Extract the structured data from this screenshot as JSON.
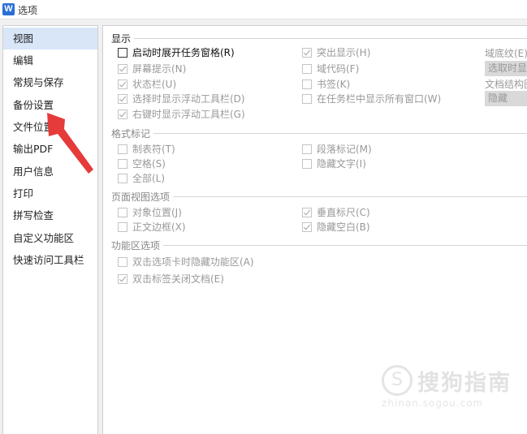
{
  "window": {
    "title": "选项",
    "icon": "wps-writer-icon"
  },
  "sidebar": {
    "selected": 0,
    "items": [
      {
        "label": "视图"
      },
      {
        "label": "编辑"
      },
      {
        "label": "常规与保存"
      },
      {
        "label": "备份设置"
      },
      {
        "label": "文件位置"
      },
      {
        "label": "输出PDF"
      },
      {
        "label": "用户信息"
      },
      {
        "label": "打印"
      },
      {
        "label": "拼写检查"
      },
      {
        "label": "自定义功能区"
      },
      {
        "label": "快速访问工具栏"
      }
    ]
  },
  "sections": {
    "display": {
      "title": "显示",
      "col1": [
        {
          "label": "启动时展开任务窗格(R)",
          "checked": false,
          "enabled": true
        },
        {
          "label": "屏幕提示(N)",
          "checked": true,
          "enabled": false
        },
        {
          "label": "状态栏(U)",
          "checked": true,
          "enabled": false
        },
        {
          "label": "选择时显示浮动工具栏(D)",
          "checked": true,
          "enabled": false
        },
        {
          "label": "右键时显示浮动工具栏(G)",
          "checked": true,
          "enabled": false
        }
      ],
      "col2": [
        {
          "label": "突出显示(H)",
          "checked": true,
          "enabled": false
        },
        {
          "label": "域代码(F)",
          "checked": false,
          "enabled": false
        },
        {
          "label": "书签(K)",
          "checked": false,
          "enabled": false
        },
        {
          "label": "在任务栏中显示所有窗口(W)",
          "checked": false,
          "enabled": false
        }
      ],
      "field_shading_label": "域底纹(E)",
      "field_shading_value": "选取时显示",
      "doc_map_label": "文档结构图",
      "doc_map_value": "隐藏"
    },
    "format_marks": {
      "title": "格式标记",
      "col1": [
        {
          "label": "制表符(T)",
          "checked": false
        },
        {
          "label": "空格(S)",
          "checked": false
        },
        {
          "label": "全部(L)",
          "checked": false
        }
      ],
      "col2": [
        {
          "label": "段落标记(M)",
          "checked": false
        },
        {
          "label": "隐藏文字(I)",
          "checked": false
        }
      ]
    },
    "page_view": {
      "title": "页面视图选项",
      "col1": [
        {
          "label": "对象位置(J)",
          "checked": false
        },
        {
          "label": "正文边框(X)",
          "checked": false
        }
      ],
      "col2": [
        {
          "label": "垂直标尺(C)",
          "checked": true
        },
        {
          "label": "隐藏空白(B)",
          "checked": true
        }
      ]
    },
    "ribbon": {
      "title": "功能区选项",
      "col1": [
        {
          "label": "双击选项卡时隐藏功能区(A)",
          "checked": false
        },
        {
          "label": "双击标签关闭文档(E)",
          "checked": true
        }
      ]
    }
  },
  "watermark": {
    "logo": "S",
    "text": "搜狗指南",
    "url": "zhinan.sogou.com"
  },
  "colors": {
    "arrow": "#e53b3b",
    "selected_bg": "#d8e6f8"
  }
}
